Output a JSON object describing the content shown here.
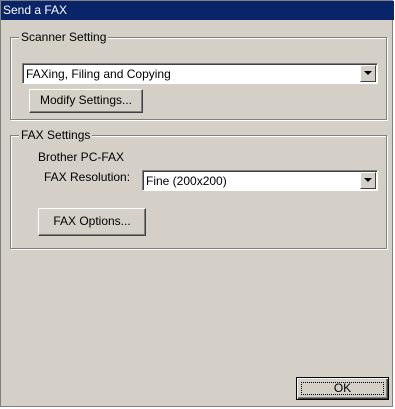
{
  "window": {
    "title": "Send a FAX"
  },
  "scanner_setting": {
    "legend": "Scanner Setting",
    "profile_select": {
      "selected": "FAXing, Filing and Copying"
    },
    "modify_button": "Modify Settings..."
  },
  "fax_settings": {
    "legend": "FAX Settings",
    "device_name": "Brother PC-FAX",
    "resolution_label": "FAX Resolution:",
    "resolution_select": {
      "selected": "Fine (200x200)"
    },
    "options_button": "FAX Options..."
  },
  "footer": {
    "ok_button": "OK"
  },
  "colors": {
    "titlebar": "#0a246a",
    "dialog_face": "#d4d0c8"
  }
}
